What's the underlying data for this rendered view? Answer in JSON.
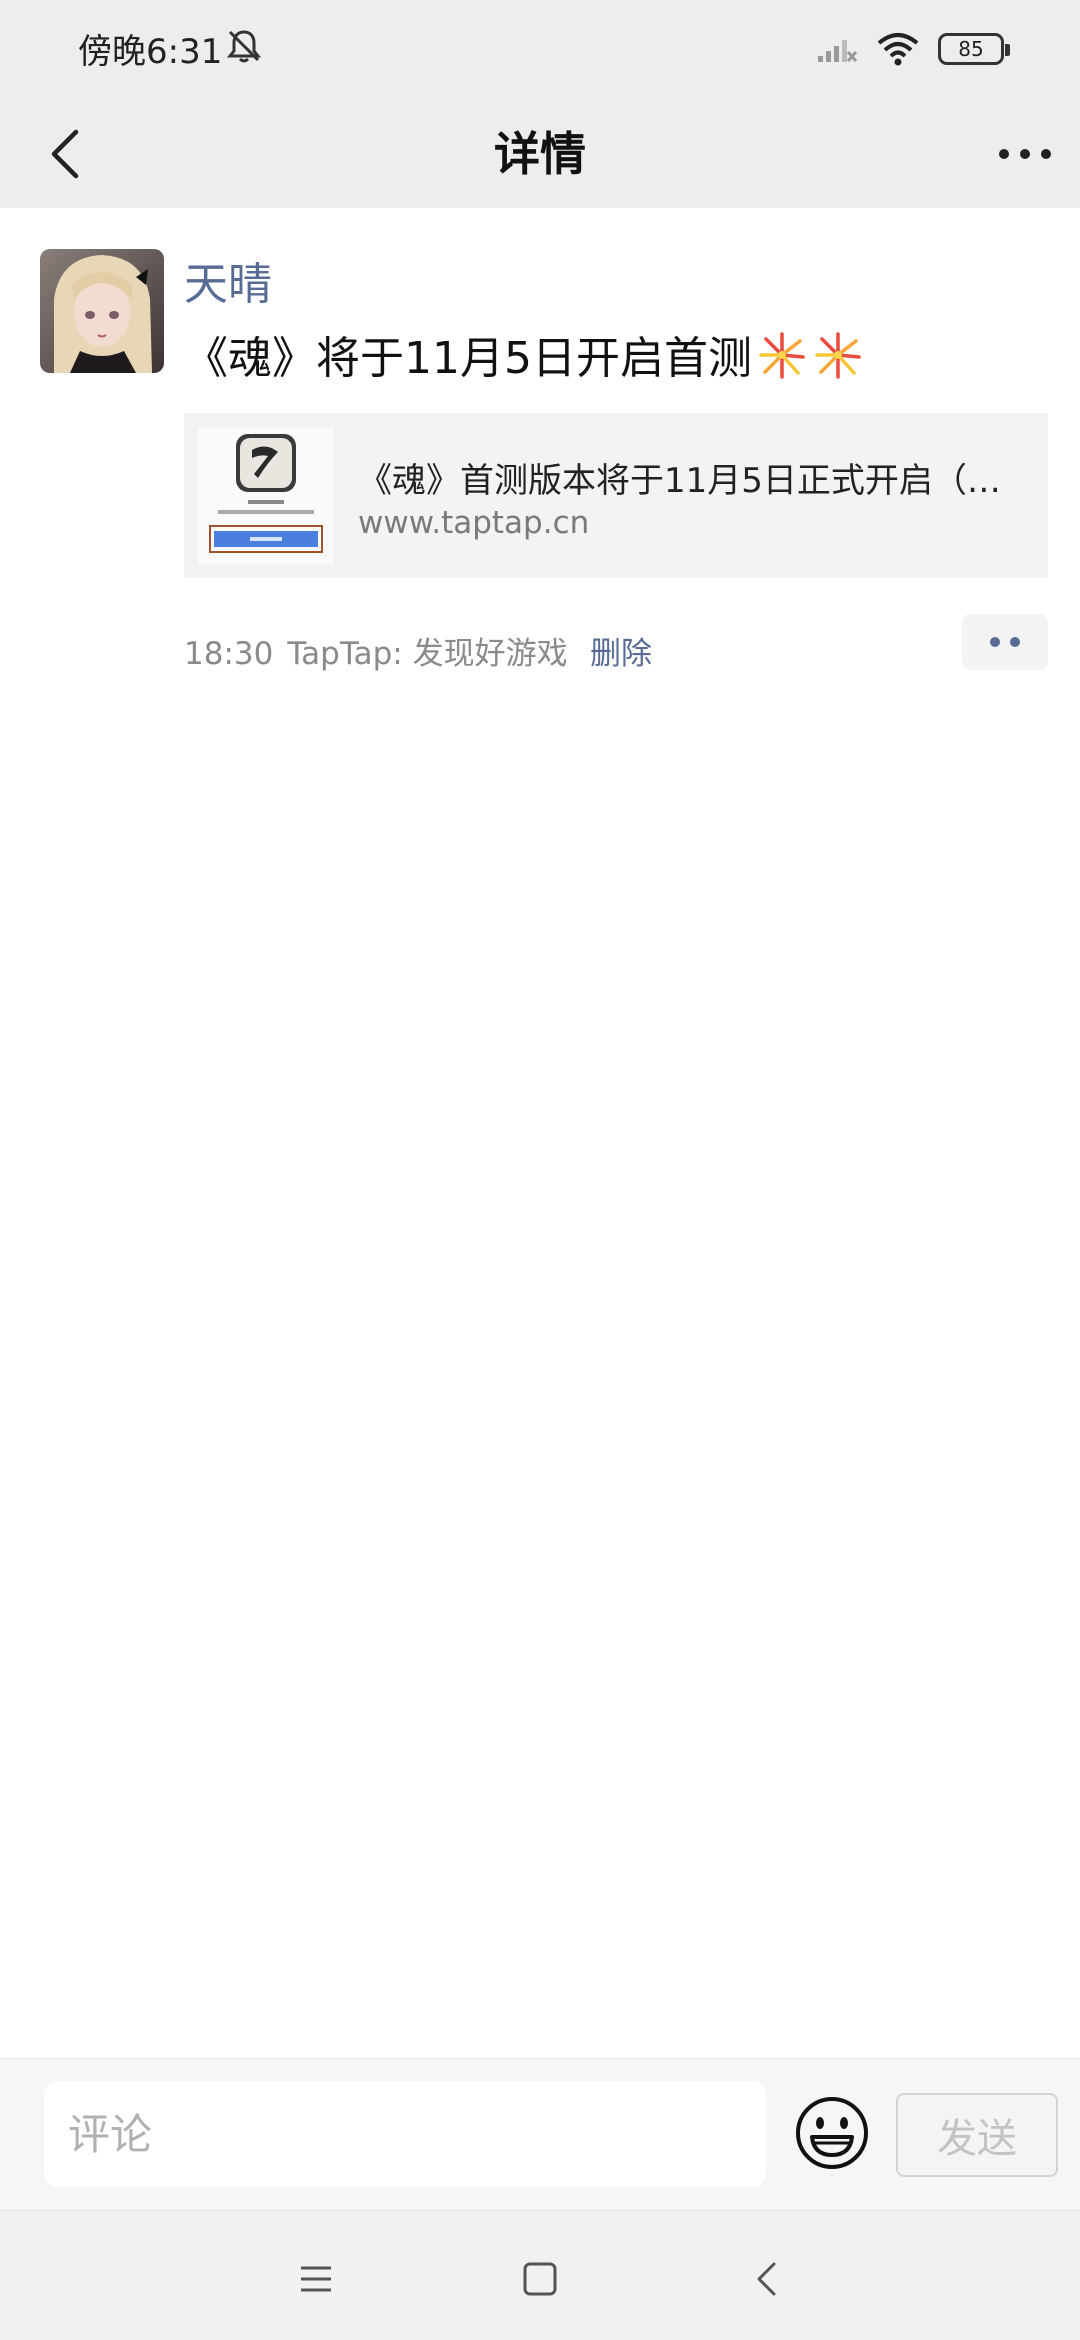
{
  "status_bar": {
    "time": "傍晚6:31",
    "battery": "85",
    "icons": [
      "bell-off-icon",
      "signal-off-icon",
      "wifi-icon",
      "battery-icon"
    ]
  },
  "header": {
    "title": "详情",
    "back_icon": "chevron-left-icon",
    "more_icon": "more-horizontal-icon"
  },
  "post": {
    "author": "天晴",
    "text": "《魂》将于11月5日开启首测",
    "emoji": [
      "fireworks",
      "fireworks"
    ],
    "link": {
      "title": "《魂》首测版本将于11月5日正式开启（…",
      "url": "www.taptap.cn"
    },
    "time": "18:30",
    "source": "TapTap: 发现好游戏",
    "delete_label": "删除"
  },
  "comment_bar": {
    "placeholder": "评论",
    "send_label": "发送",
    "emoji_icon": "smiley-icon"
  },
  "nav_bar": {
    "icons": [
      "menu-icon",
      "home-square-icon",
      "back-icon"
    ]
  },
  "colors": {
    "accent_link": "#576b95",
    "header_bg": "#ededed"
  }
}
